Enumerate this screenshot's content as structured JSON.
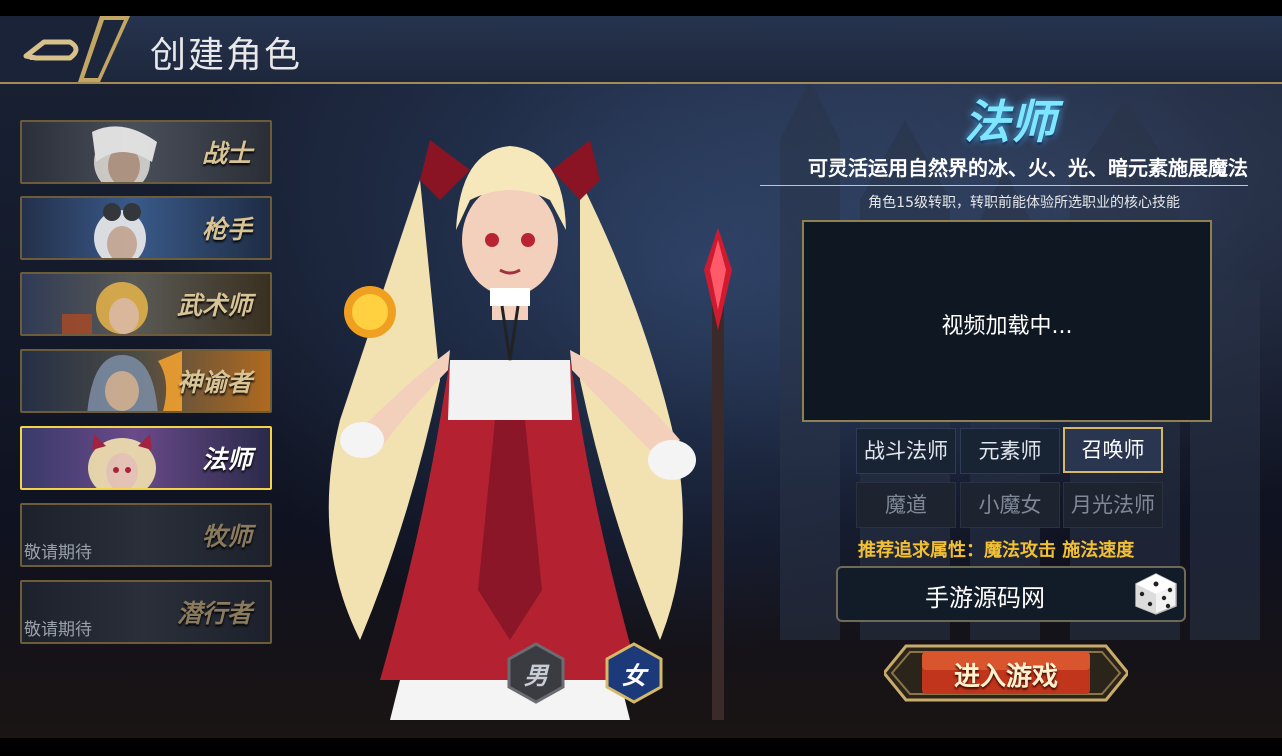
{
  "header": {
    "title": "创建角色"
  },
  "classes": [
    {
      "name": "战士",
      "status": ""
    },
    {
      "name": "枪手",
      "status": ""
    },
    {
      "name": "武术师",
      "status": ""
    },
    {
      "name": "神谕者",
      "status": ""
    },
    {
      "name": "法师",
      "status": ""
    },
    {
      "name": "牧师",
      "status": "敬请期待"
    },
    {
      "name": "潜行者",
      "status": "敬请期待"
    }
  ],
  "selected_class": {
    "title": "法师",
    "description": "可灵活运用自然界的冰、火、光、暗元素施展魔法",
    "note": "角色15级转职，转职前能体验所选职业的核心技能",
    "video_status": "视频加载中..."
  },
  "subclasses": [
    {
      "label": "战斗法师",
      "state": "available"
    },
    {
      "label": "元素师",
      "state": "available"
    },
    {
      "label": "召唤师",
      "state": "selected"
    },
    {
      "label": "魔道",
      "state": "locked"
    },
    {
      "label": "小魔女",
      "state": "locked"
    },
    {
      "label": "月光法师",
      "state": "locked"
    }
  ],
  "recommend": {
    "label": "推荐追求属性：",
    "attributes": "魔法攻击 施法速度"
  },
  "name_input": {
    "value": "手游源码网"
  },
  "gender": {
    "male": "男",
    "female": "女",
    "selected": "女"
  },
  "enter_button": {
    "label": "进入游戏"
  },
  "colors": {
    "accent_gold": "#d6b866",
    "title_cyan": "#7fe6ff",
    "recommend_yellow": "#f3c033",
    "enter_red": "#c0351c"
  }
}
